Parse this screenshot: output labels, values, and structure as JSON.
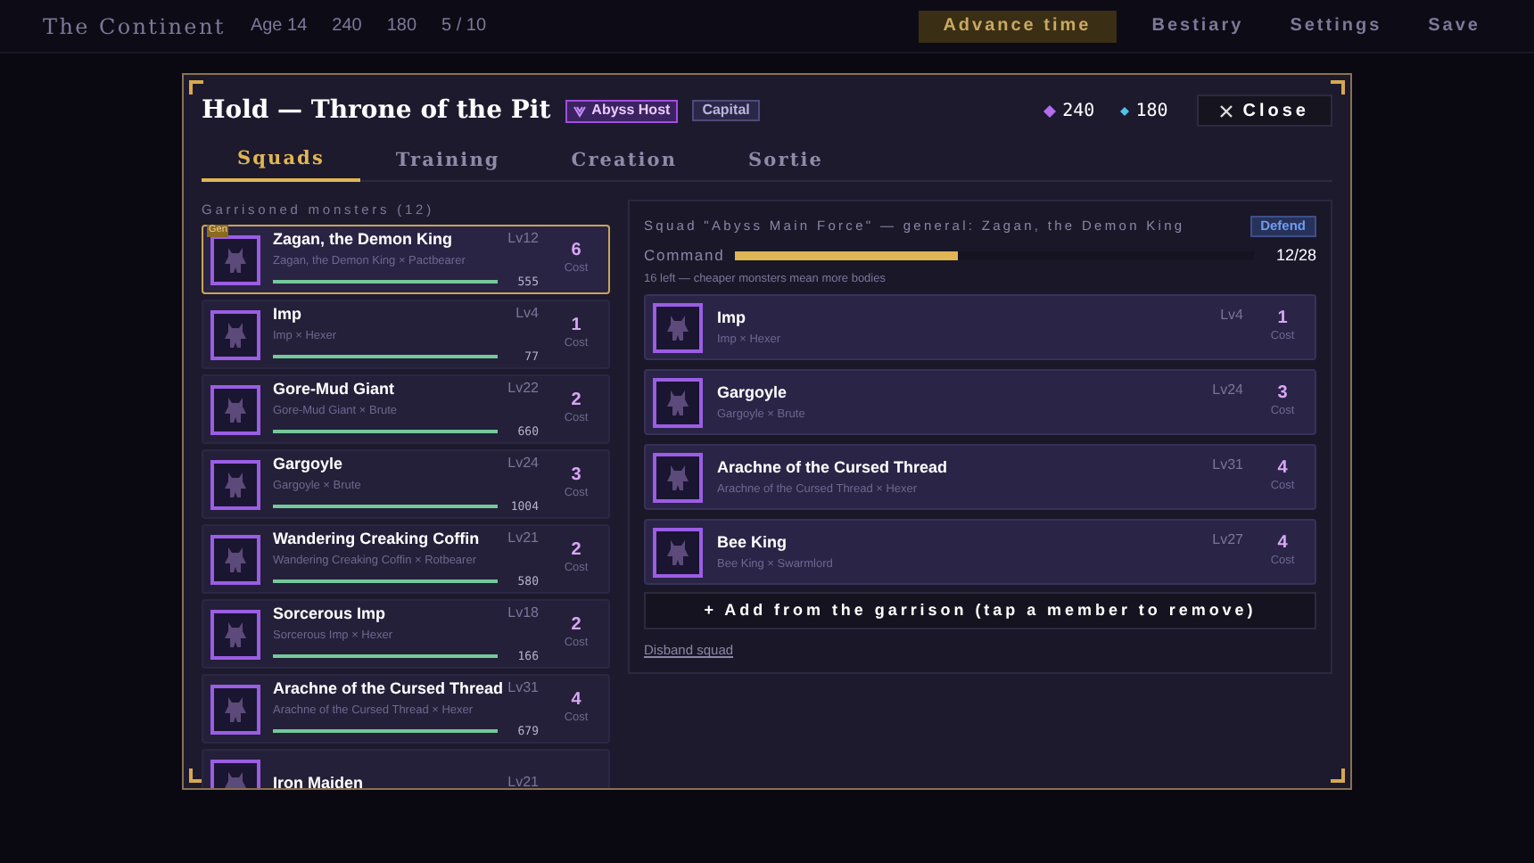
{
  "top_bar": {
    "title": "The Continent",
    "age": "Age 14",
    "gems": "240",
    "mana": "180",
    "count": "5 / 10",
    "buttons": [
      {
        "label": "Advance time",
        "kind": "primary"
      },
      {
        "label": "Bestiary",
        "kind": "plain"
      },
      {
        "label": "Settings",
        "kind": "plain"
      },
      {
        "label": "Save",
        "kind": "plain"
      }
    ]
  },
  "modal": {
    "title": "Hold — Throne of the Pit",
    "badges": [
      {
        "label": "Abyss Host",
        "kind": "faction"
      },
      {
        "label": "Capital",
        "kind": "tag"
      }
    ],
    "gems": "240",
    "mana": "180",
    "close": "Close",
    "tabs": [
      {
        "label": "Squads",
        "selected": true
      },
      {
        "label": "Training",
        "selected": false
      },
      {
        "label": "Creation",
        "selected": false
      },
      {
        "label": "Sortie",
        "selected": false
      }
    ],
    "garrison": {
      "heading": "Garrisoned monsters (12)",
      "monsters": [
        {
          "name": "Zagan, the Demon King",
          "pairing": "Zagan, the Demon King × Pactbearer",
          "level_text": "Lv12",
          "exp": "555",
          "cost": "6",
          "cost_label": "Cost",
          "selected": true,
          "badge": "Gen",
          "hp": {
            "level": 1
          }
        },
        {
          "name": "Imp",
          "pairing": "Imp × Hexer",
          "level_text": "Lv4",
          "exp": "77",
          "cost": "1",
          "cost_label": "Cost",
          "selected": false,
          "hp": {
            "level": 1
          }
        },
        {
          "name": "Gore-Mud Giant",
          "pairing": "Gore-Mud Giant × Brute",
          "level_text": "Lv22",
          "exp": "660",
          "cost": "2",
          "cost_label": "Cost",
          "selected": false,
          "hp": {
            "level": 1
          }
        },
        {
          "name": "Gargoyle",
          "pairing": "Gargoyle × Brute",
          "level_text": "Lv24",
          "exp": "1004",
          "cost": "3",
          "cost_label": "Cost",
          "selected": false,
          "hp": {
            "level": 1
          }
        },
        {
          "name": "Wandering Creaking Coffin",
          "pairing": "Wandering Creaking Coffin × Rotbearer",
          "level_text": "Lv21",
          "exp": "580",
          "cost": "2",
          "cost_label": "Cost",
          "selected": false,
          "hp": {
            "level": 1
          }
        },
        {
          "name": "Sorcerous Imp",
          "pairing": "Sorcerous Imp × Hexer",
          "level_text": "Lv18",
          "exp": "166",
          "cost": "2",
          "cost_label": "Cost",
          "selected": false,
          "hp": {
            "level": 1
          }
        },
        {
          "name": "Arachne of the Cursed Thread",
          "pairing": "Arachne of the Cursed Thread × Hexer",
          "level_text": "Lv31",
          "exp": "679",
          "cost": "4",
          "cost_label": "Cost",
          "selected": false,
          "hp": {
            "level": 1
          }
        },
        {
          "name": "Iron Maiden",
          "level_text": "Lv21",
          "selected": false
        }
      ]
    },
    "squad": {
      "title": "Squad \"Abyss Main Force\" — general: Zagan, the Demon King",
      "stance": "Defend",
      "command_label": "Command",
      "command": {
        "level": 0.4286
      },
      "command_reading": "12/28",
      "hint": "16 left — cheaper monsters mean more bodies",
      "members": [
        {
          "name": "Imp",
          "pairing": "Imp × Hexer",
          "level_text": "Lv4",
          "cost": "1",
          "cost_label": "Cost"
        },
        {
          "name": "Gargoyle",
          "pairing": "Gargoyle × Brute",
          "level_text": "Lv24",
          "cost": "3",
          "cost_label": "Cost"
        },
        {
          "name": "Arachne of the Cursed Thread",
          "pairing": "Arachne of the Cursed Thread × Hexer",
          "level_text": "Lv31",
          "cost": "4",
          "cost_label": "Cost"
        },
        {
          "name": "Bee King",
          "pairing": "Bee King × Swarmlord",
          "level_text": "Lv27",
          "cost": "4",
          "cost_label": "Cost"
        }
      ],
      "add_button": "+ Add from the garrison (tap a member to remove)",
      "disband": "Disband squad"
    }
  }
}
